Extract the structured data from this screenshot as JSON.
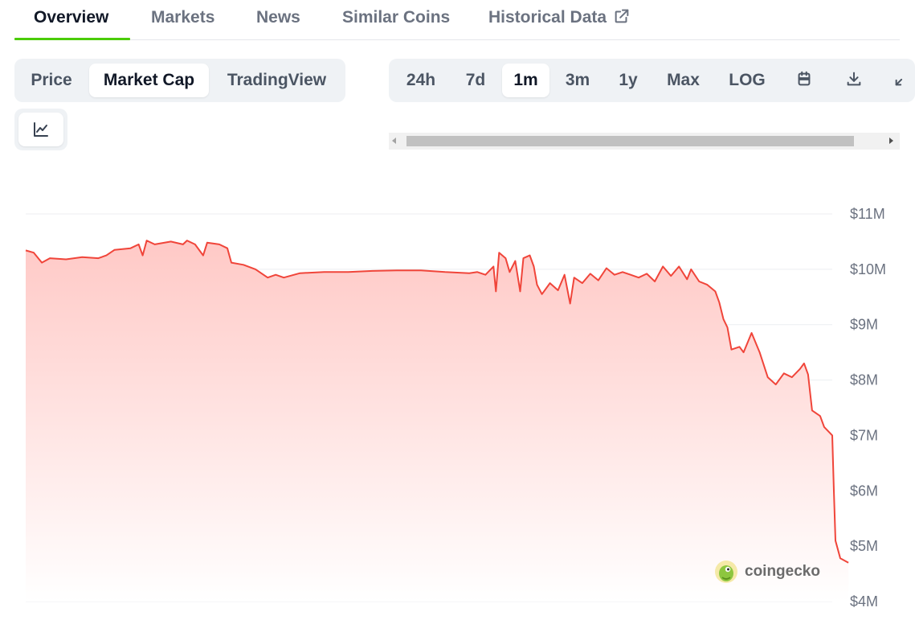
{
  "tabs": [
    {
      "label": "Overview",
      "active": true
    },
    {
      "label": "Markets"
    },
    {
      "label": "News"
    },
    {
      "label": "Similar Coins"
    },
    {
      "label": "Historical Data"
    }
  ],
  "chart_type_group": [
    {
      "label": "Price"
    },
    {
      "label": "Market Cap",
      "active": true
    },
    {
      "label": "TradingView"
    }
  ],
  "range_group": [
    {
      "label": "24h"
    },
    {
      "label": "7d"
    },
    {
      "label": "1m",
      "active": true
    },
    {
      "label": "3m"
    },
    {
      "label": "1y"
    },
    {
      "label": "Max"
    },
    {
      "label": "LOG"
    }
  ],
  "icons": {
    "external_link": "external-link-icon",
    "calendar": "calendar-icon",
    "download": "download-icon",
    "expand": "expand-icon",
    "line_chart": "line-chart-icon"
  },
  "colors": {
    "accent_tab": "#4bcc00",
    "line": "#f0453a",
    "fill_top": "#ffc9c6",
    "fill_bottom": "#ffffff"
  },
  "watermark": {
    "text": "coingecko"
  },
  "chart_data": {
    "type": "area",
    "y_tick_labels": [
      "$11M",
      "$10M",
      "$9M",
      "$8M",
      "$7M",
      "$6M",
      "$5M",
      "$4M"
    ],
    "ylim": [
      4,
      11
    ],
    "y_unit": "$M",
    "xlim": [
      0,
      100
    ],
    "grid": true,
    "points": [
      [
        0,
        10.34
      ],
      [
        1,
        10.3
      ],
      [
        2,
        10.12
      ],
      [
        3,
        10.2
      ],
      [
        5,
        10.18
      ],
      [
        7,
        10.22
      ],
      [
        9,
        10.2
      ],
      [
        10,
        10.25
      ],
      [
        11,
        10.35
      ],
      [
        13,
        10.38
      ],
      [
        14,
        10.45
      ],
      [
        14.5,
        10.25
      ],
      [
        15,
        10.52
      ],
      [
        16,
        10.45
      ],
      [
        18,
        10.5
      ],
      [
        19.5,
        10.45
      ],
      [
        20,
        10.52
      ],
      [
        21,
        10.45
      ],
      [
        22,
        10.25
      ],
      [
        22.5,
        10.48
      ],
      [
        24,
        10.45
      ],
      [
        25,
        10.38
      ],
      [
        25.5,
        10.12
      ],
      [
        27,
        10.08
      ],
      [
        28.5,
        10.0
      ],
      [
        30,
        9.85
      ],
      [
        31,
        9.9
      ],
      [
        32,
        9.85
      ],
      [
        34,
        9.93
      ],
      [
        37,
        9.95
      ],
      [
        40,
        9.95
      ],
      [
        43,
        9.97
      ],
      [
        46,
        9.98
      ],
      [
        49,
        9.98
      ],
      [
        52,
        9.95
      ],
      [
        55,
        9.93
      ],
      [
        56,
        9.95
      ],
      [
        57,
        9.9
      ],
      [
        58,
        10.05
      ],
      [
        58.3,
        9.6
      ],
      [
        58.7,
        10.3
      ],
      [
        59.5,
        10.2
      ],
      [
        60,
        9.95
      ],
      [
        60.7,
        10.15
      ],
      [
        61.3,
        9.6
      ],
      [
        61.7,
        10.2
      ],
      [
        62.5,
        10.25
      ],
      [
        63,
        10.05
      ],
      [
        63.4,
        9.72
      ],
      [
        64,
        9.55
      ],
      [
        65,
        9.75
      ],
      [
        66,
        9.62
      ],
      [
        66.8,
        9.9
      ],
      [
        67.5,
        9.38
      ],
      [
        68,
        9.85
      ],
      [
        69,
        9.75
      ],
      [
        70,
        9.92
      ],
      [
        71,
        9.8
      ],
      [
        72,
        10.02
      ],
      [
        73,
        9.9
      ],
      [
        74,
        9.95
      ],
      [
        75,
        9.9
      ],
      [
        76,
        9.85
      ],
      [
        77,
        9.92
      ],
      [
        78,
        9.78
      ],
      [
        79,
        10.05
      ],
      [
        80,
        9.88
      ],
      [
        81,
        10.05
      ],
      [
        82,
        9.82
      ],
      [
        82.5,
        10.0
      ],
      [
        83.5,
        9.78
      ],
      [
        84.5,
        9.72
      ],
      [
        85.5,
        9.6
      ],
      [
        86,
        9.4
      ],
      [
        86.5,
        9.1
      ],
      [
        87,
        8.95
      ],
      [
        87.5,
        8.55
      ],
      [
        88.5,
        8.6
      ],
      [
        89,
        8.5
      ],
      [
        90,
        8.85
      ],
      [
        91,
        8.5
      ],
      [
        92,
        8.05
      ],
      [
        93,
        7.92
      ],
      [
        94,
        8.12
      ],
      [
        95,
        8.05
      ],
      [
        96,
        8.2
      ],
      [
        96.5,
        8.3
      ],
      [
        97,
        8.1
      ],
      [
        97.5,
        7.45
      ],
      [
        98.5,
        7.35
      ],
      [
        99,
        7.15
      ],
      [
        100,
        7.0
      ],
      [
        100.2,
        6.0
      ],
      [
        100.4,
        5.1
      ],
      [
        101,
        4.78
      ],
      [
        102,
        4.7
      ]
    ]
  }
}
